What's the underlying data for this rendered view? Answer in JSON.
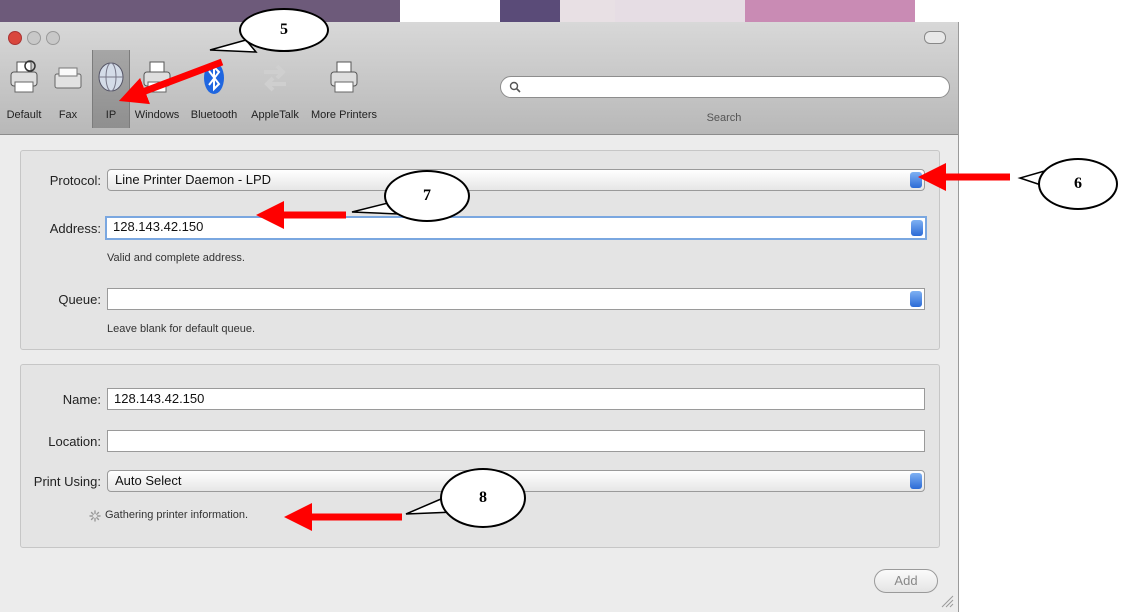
{
  "toolbar": {
    "items": [
      {
        "label": "Default",
        "icon": "printer-icon"
      },
      {
        "label": "Fax",
        "icon": "fax-icon"
      },
      {
        "label": "IP",
        "icon": "globe-icon",
        "selected": true
      },
      {
        "label": "Windows",
        "icon": "printer-icon"
      },
      {
        "label": "Bluetooth",
        "icon": "bluetooth-icon"
      },
      {
        "label": "AppleTalk",
        "icon": "appletalk-icon"
      },
      {
        "label": "More Printers",
        "icon": "printer-icon"
      }
    ],
    "search_label": "Search",
    "search_placeholder": ""
  },
  "connection": {
    "protocol_label": "Protocol:",
    "protocol_value": "Line Printer Daemon - LPD",
    "address_label": "Address:",
    "address_value": "128.143.42.150",
    "address_hint": "Valid and complete address.",
    "queue_label": "Queue:",
    "queue_value": "",
    "queue_hint": "Leave blank for default queue."
  },
  "details": {
    "name_label": "Name:",
    "name_value": "128.143.42.150",
    "location_label": "Location:",
    "location_value": "",
    "print_using_label": "Print Using:",
    "print_using_value": "Auto Select",
    "status": "Gathering printer information."
  },
  "add_button": "Add",
  "callouts": [
    "5",
    "6",
    "7",
    "8"
  ],
  "colors": {
    "arrow": "#ff0000",
    "close": "#d9473d",
    "minimize": "#e0a532",
    "zoom": "#52a84a",
    "accent": "#2c6bd6"
  }
}
